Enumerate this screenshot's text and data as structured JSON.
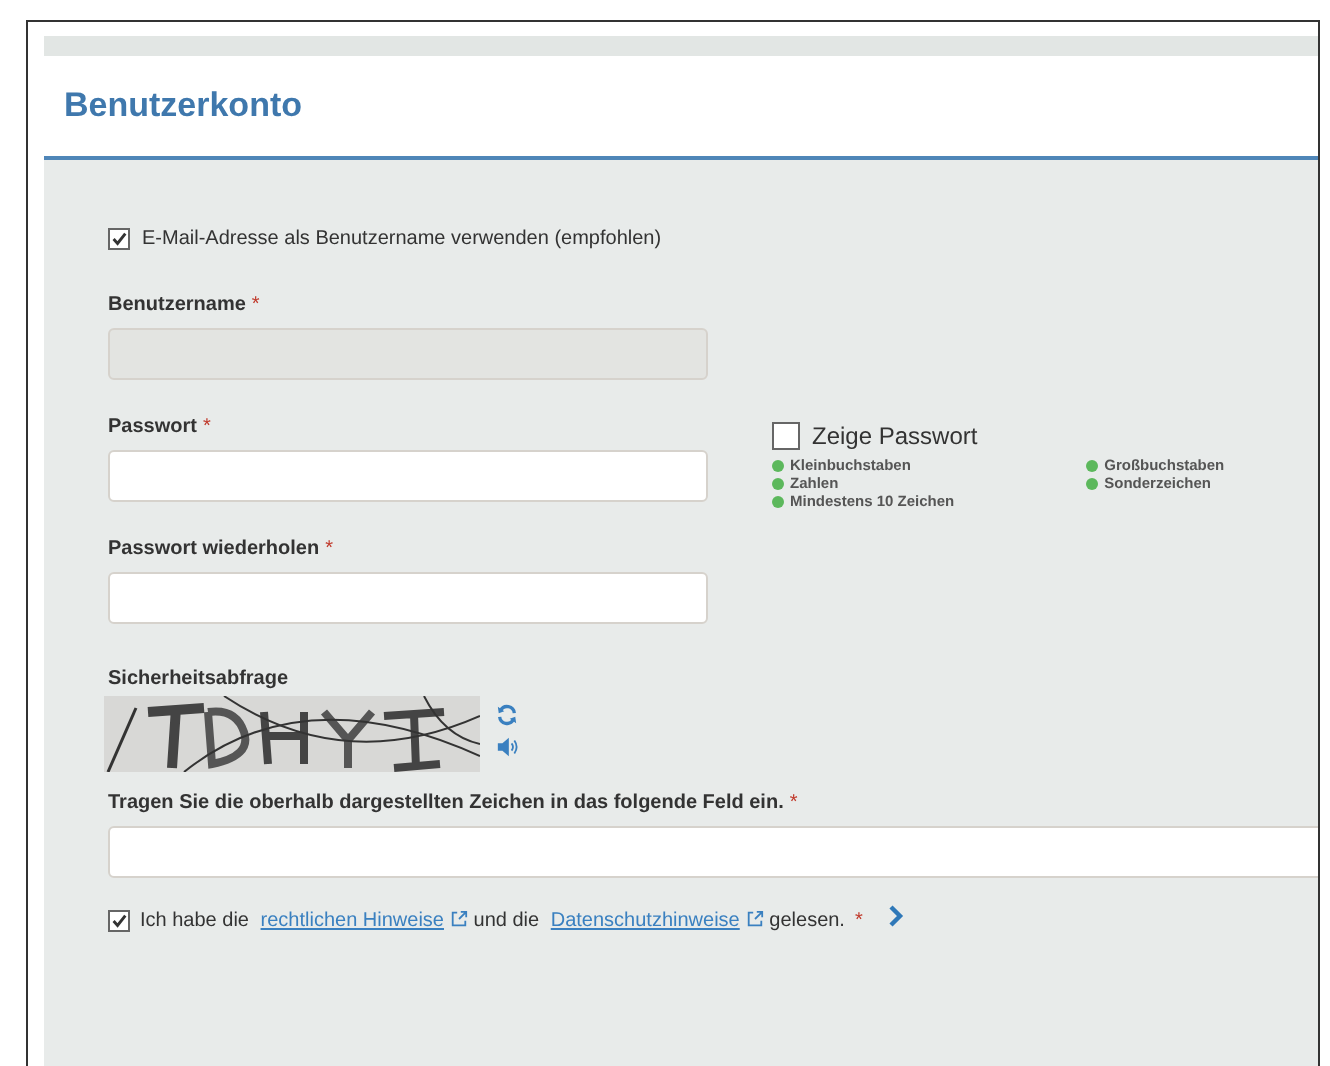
{
  "title": "Benutzerkonto",
  "required_mark": "*",
  "email_as_username": {
    "label": "E-Mail-Adresse als Benutzername verwenden (empfohlen)",
    "checked": true
  },
  "username": {
    "label": "Benutzername",
    "required": true,
    "disabled": true
  },
  "password": {
    "label": "Passwort",
    "required": true,
    "disabled": false
  },
  "password_repeat": {
    "label": "Passwort wiederholen",
    "required": true,
    "disabled": false
  },
  "show_password": {
    "label": "Zeige Passwort",
    "checked": false
  },
  "password_rules": [
    {
      "label": "Kleinbuchstaben",
      "met": true
    },
    {
      "label": "Zahlen",
      "met": true
    },
    {
      "label": "Mindestens 10 Zeichen",
      "met": true
    },
    {
      "label": "Großbuchstaben",
      "met": true
    },
    {
      "label": "Sonderzeichen",
      "met": true
    }
  ],
  "captcha": {
    "label": "Sicherheitsabfrage",
    "input_label": "Tragen Sie die oberhalb dargestellten Zeichen in das folgende Feld ein.",
    "required": true
  },
  "consent": {
    "checked": true,
    "required": true,
    "parts": [
      {
        "kind": "text",
        "text": "Ich habe die"
      },
      {
        "kind": "link",
        "text": "rechtlichen Hinweise"
      },
      {
        "kind": "text",
        "text": "und die"
      },
      {
        "kind": "link",
        "text": "Datenschutzhinweise"
      },
      {
        "kind": "text",
        "text": "gelesen."
      }
    ]
  }
}
